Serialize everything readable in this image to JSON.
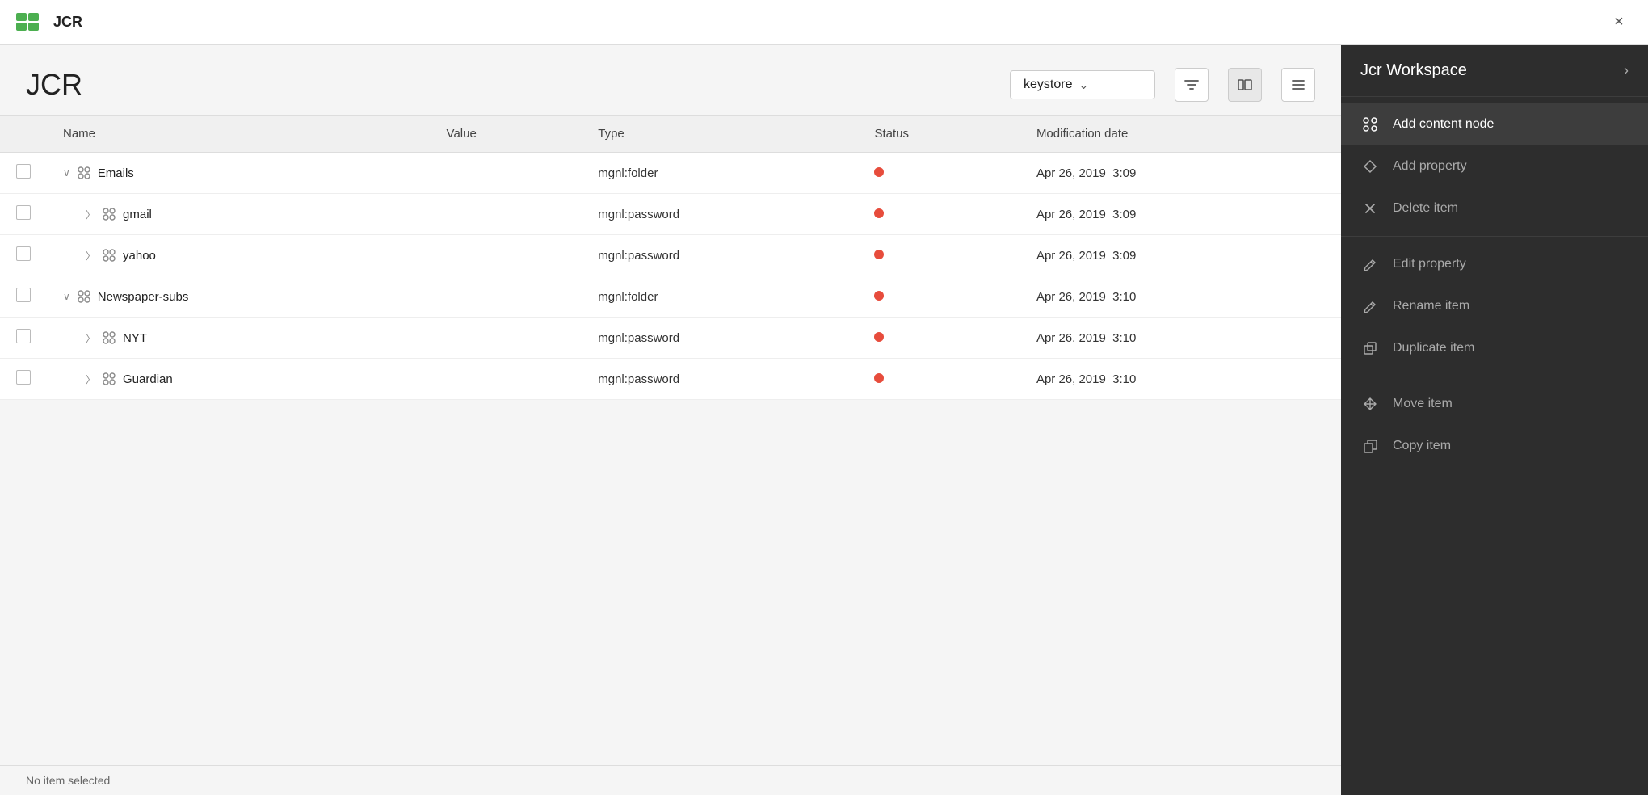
{
  "topbar": {
    "logo_label": "JCR",
    "title": "JCR",
    "close_label": "×"
  },
  "jcr_header": {
    "title": "JCR",
    "workspace": "keystore",
    "chevron": "⌄"
  },
  "toolbar": {
    "filter_icon": "filter",
    "columns_icon": "columns",
    "menu_icon": "menu"
  },
  "table": {
    "columns": [
      "Name",
      "Value",
      "Type",
      "Status",
      "Modification date"
    ],
    "rows": [
      {
        "id": "emails",
        "indent": 0,
        "expandable": true,
        "expanded": true,
        "name": "Emails",
        "value": "",
        "type": "mgnl:folder",
        "status": "red",
        "date": "Apr 26, 2019",
        "time": "3:09"
      },
      {
        "id": "gmail",
        "indent": 1,
        "expandable": true,
        "expanded": false,
        "name": "gmail",
        "value": "",
        "type": "mgnl:password",
        "status": "red",
        "date": "Apr 26, 2019",
        "time": "3:09"
      },
      {
        "id": "yahoo",
        "indent": 1,
        "expandable": true,
        "expanded": false,
        "name": "yahoo",
        "value": "",
        "type": "mgnl:password",
        "status": "red",
        "date": "Apr 26, 2019",
        "time": "3:09"
      },
      {
        "id": "newspaper-subs",
        "indent": 0,
        "expandable": true,
        "expanded": true,
        "name": "Newspaper-subs",
        "value": "",
        "type": "mgnl:folder",
        "status": "red",
        "date": "Apr 26, 2019",
        "time": "3:10"
      },
      {
        "id": "nyt",
        "indent": 1,
        "expandable": true,
        "expanded": false,
        "name": "NYT",
        "value": "",
        "type": "mgnl:password",
        "status": "red",
        "date": "Apr 26, 2019",
        "time": "3:10"
      },
      {
        "id": "guardian",
        "indent": 1,
        "expandable": true,
        "expanded": false,
        "name": "Guardian",
        "value": "",
        "type": "mgnl:password",
        "status": "red",
        "date": "Apr 26, 2019",
        "time": "3:10"
      }
    ]
  },
  "status_bar": {
    "text": "No item selected"
  },
  "right_panel": {
    "title": "Jcr Workspace",
    "chevron": "›",
    "menu_items": [
      {
        "id": "add-content-node",
        "icon": "node",
        "label": "Add content node",
        "active": true
      },
      {
        "id": "add-property",
        "icon": "diamond",
        "label": "Add property",
        "active": false
      },
      {
        "id": "delete-item",
        "icon": "close",
        "label": "Delete item",
        "active": false
      },
      {
        "id": "divider1",
        "type": "divider"
      },
      {
        "id": "edit-property",
        "icon": "pencil",
        "label": "Edit property",
        "active": false
      },
      {
        "id": "rename-item",
        "icon": "pencil",
        "label": "Rename item",
        "active": false
      },
      {
        "id": "duplicate-item",
        "icon": "duplicate",
        "label": "Duplicate item",
        "active": false
      },
      {
        "id": "divider2",
        "type": "divider"
      },
      {
        "id": "move-item",
        "icon": "move",
        "label": "Move item",
        "active": false
      },
      {
        "id": "copy-item",
        "icon": "copy",
        "label": "Copy item",
        "active": false
      }
    ]
  }
}
